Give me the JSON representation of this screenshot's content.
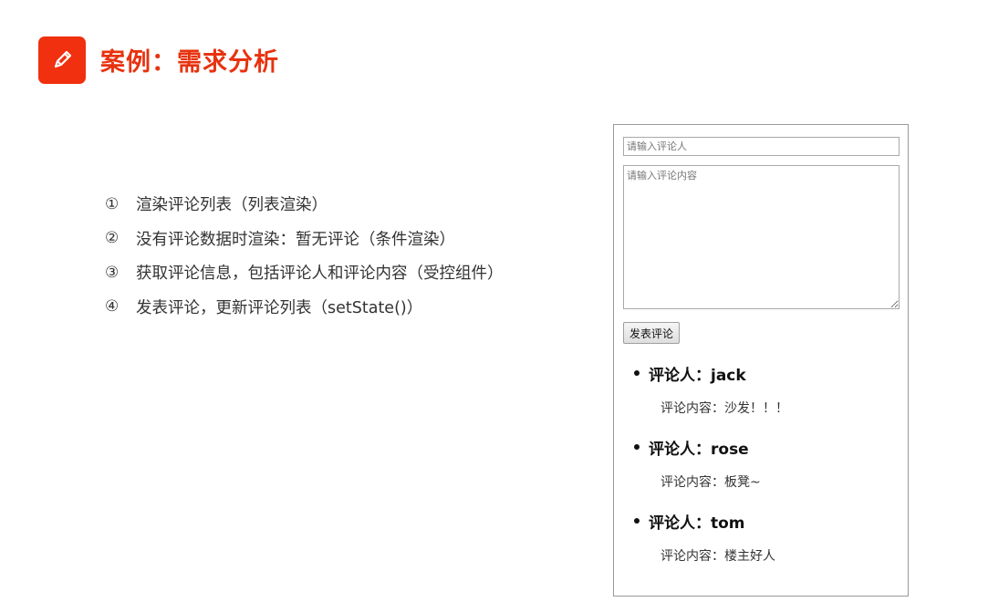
{
  "header": {
    "icon": "pencil-icon",
    "accent_color": "#f0300e",
    "title": "案例：需求分析"
  },
  "requirements": [
    {
      "num": "①",
      "text": "渲染评论列表（列表渲染）"
    },
    {
      "num": "②",
      "text": "没有评论数据时渲染：暂无评论（条件渲染）"
    },
    {
      "num": "③",
      "text": "获取评论信息，包括评论人和评论内容（受控组件）"
    },
    {
      "num": "④",
      "text": "发表评论，更新评论列表（setState()）"
    }
  ],
  "demo": {
    "author_placeholder": "请输入评论人",
    "content_placeholder": "请输入评论内容",
    "submit_label": "发表评论",
    "comments": [
      {
        "author": "评论人：jack",
        "content": "评论内容：沙发！！！"
      },
      {
        "author": "评论人：rose",
        "content": "评论内容：板凳~"
      },
      {
        "author": "评论人：tom",
        "content": "评论内容：楼主好人"
      }
    ]
  }
}
